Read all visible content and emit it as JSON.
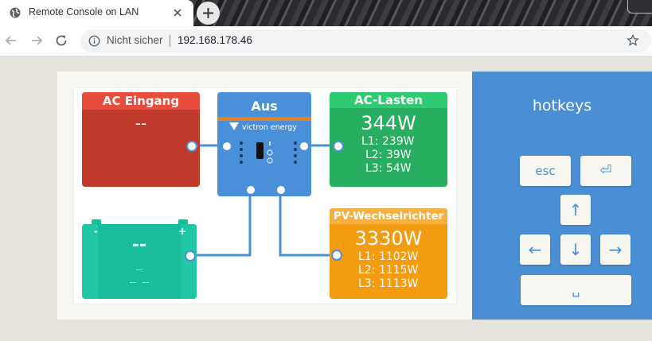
{
  "browser": {
    "tab_title": "Remote Console on LAN",
    "security_label": "Nicht sicher",
    "url": "192.168.178.46"
  },
  "overview": {
    "ac_input": {
      "title": "AC Eingang",
      "value": "--",
      "color": "#c0392b",
      "title_color": "#e74c3c"
    },
    "inverter": {
      "state": "Aus",
      "brand": "victron energy",
      "color": "#4a90d9"
    },
    "ac_loads": {
      "title": "AC-Lasten",
      "total": "344W",
      "l1": "L1: 239W",
      "l2": "L2: 39W",
      "l3": "L3: 54W",
      "color": "#27ae60",
      "title_color": "#2ecc71"
    },
    "battery": {
      "minus": "-",
      "plus": "+",
      "main": "--",
      "line2": "--",
      "line3": "--  --",
      "color": "#1abc9c"
    },
    "pv_inverter": {
      "title": "PV-Wechselrichter",
      "total": "3330W",
      "l1": "L1: 1102W",
      "l2": "L2: 1115W",
      "l3": "L3: 1113W",
      "color": "#f39c12",
      "title_color": "#f5b041"
    }
  },
  "hotkeys": {
    "title": "hotkeys",
    "esc": "esc",
    "enter": "⏎",
    "up": "↑",
    "left": "←",
    "down": "↓",
    "right": "→",
    "space": "␣"
  }
}
